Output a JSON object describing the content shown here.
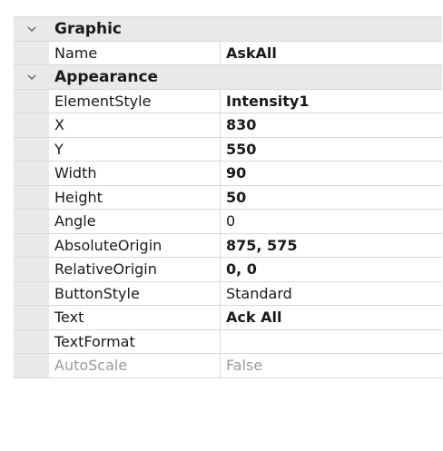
{
  "categories": [
    {
      "title": "Graphic",
      "rows": [
        {
          "name": "Name",
          "value": "AskAll"
        }
      ]
    },
    {
      "title": "Appearance",
      "rows": [
        {
          "name": "ElementStyle",
          "value": "Intensity1"
        },
        {
          "name": "X",
          "value": "830"
        },
        {
          "name": "Y",
          "value": "550"
        },
        {
          "name": "Width",
          "value": "90"
        },
        {
          "name": "Height",
          "value": "50"
        },
        {
          "name": "Angle",
          "value": "0"
        },
        {
          "name": "AbsoluteOrigin",
          "value": "875, 575"
        },
        {
          "name": "RelativeOrigin",
          "value": "0, 0"
        },
        {
          "name": "ButtonStyle",
          "value": "Standard"
        },
        {
          "name": "Text",
          "value": "Ack All"
        },
        {
          "name": "TextFormat",
          "value": ""
        },
        {
          "name": "AutoScale",
          "value": "False"
        }
      ]
    }
  ],
  "icons": {
    "expanded": "chevron-down-icon"
  }
}
